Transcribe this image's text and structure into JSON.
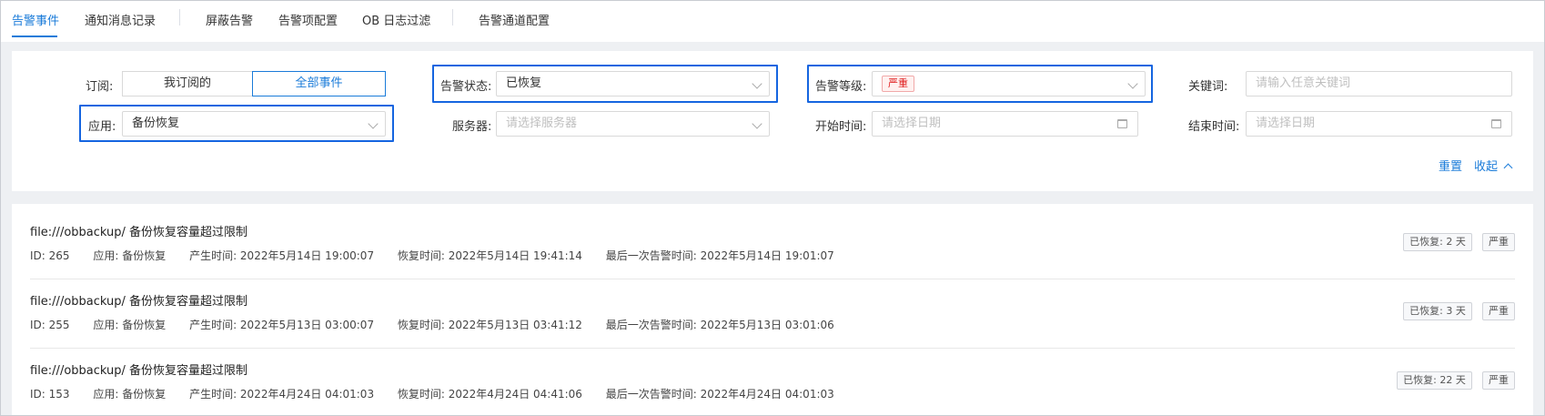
{
  "tabs": [
    {
      "label": "告警事件",
      "active": true
    },
    {
      "label": "通知消息记录",
      "active": false
    },
    {
      "label": "屏蔽告警",
      "active": false
    },
    {
      "label": "告警项配置",
      "active": false
    },
    {
      "label": "OB 日志过滤",
      "active": false
    },
    {
      "label": "告警通道配置",
      "active": false
    }
  ],
  "filters": {
    "subscribe": {
      "label": "订阅:",
      "options": [
        "我订阅的",
        "全部事件"
      ],
      "selected": "全部事件"
    },
    "status": {
      "label": "告警状态:",
      "value": "已恢复"
    },
    "level": {
      "label": "告警等级:",
      "value": "严重"
    },
    "keyword": {
      "label": "关键词:",
      "placeholder": "请输入任意关键词"
    },
    "app": {
      "label": "应用:",
      "value": "备份恢复"
    },
    "server": {
      "label": "服务器:",
      "placeholder": "请选择服务器"
    },
    "start_time": {
      "label": "开始时间:",
      "placeholder": "请选择日期"
    },
    "end_time": {
      "label": "结束时间:",
      "placeholder": "请选择日期"
    },
    "reset_label": "重置",
    "collapse_label": "收起"
  },
  "events": [
    {
      "title": "file:///obbackup/ 备份恢复容量超过限制",
      "id": "ID: 265",
      "app": "应用: 备份恢复",
      "created": "产生时间: 2022年5月14日 19:00:07",
      "recovered": "恢复时间: 2022年5月14日 19:41:14",
      "last_alert": "最后一次告警时间: 2022年5月14日 19:01:07",
      "status_tag": "已恢复: 2 天",
      "level_tag": "严重"
    },
    {
      "title": "file:///obbackup/ 备份恢复容量超过限制",
      "id": "ID: 255",
      "app": "应用: 备份恢复",
      "created": "产生时间: 2022年5月13日 03:00:07",
      "recovered": "恢复时间: 2022年5月13日 03:41:12",
      "last_alert": "最后一次告警时间: 2022年5月13日 03:01:06",
      "status_tag": "已恢复: 3 天",
      "level_tag": "严重"
    },
    {
      "title": "file:///obbackup/ 备份恢复容量超过限制",
      "id": "ID: 153",
      "app": "应用: 备份恢复",
      "created": "产生时间: 2022年4月24日 04:01:03",
      "recovered": "恢复时间: 2022年4月24日 04:41:06",
      "last_alert": "最后一次告警时间: 2022年4月24日 04:01:03",
      "status_tag": "已恢复: 22 天",
      "level_tag": "严重"
    }
  ],
  "colors": {
    "accent": "#1a7bd9",
    "highlight": "#1565e0",
    "danger": "#e02020"
  }
}
